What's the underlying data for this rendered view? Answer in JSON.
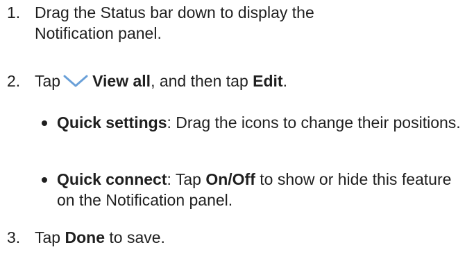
{
  "steps": [
    {
      "number": "1.",
      "text": "Drag the Status bar down to display the Notification panel."
    },
    {
      "number": "2.",
      "prefix": "Tap",
      "icon": "chevron-down-icon",
      "icon_color": "#6aa0d8",
      "view_all": "View all",
      "middle": ", and then tap",
      "edit": "Edit",
      "suffix": "."
    },
    {
      "number": "3.",
      "prefix": "Tap",
      "done": "Done",
      "suffix": "to save."
    }
  ],
  "bullets": [
    {
      "term": "Quick settings",
      "text": ": Drag the icons to change their positions."
    },
    {
      "term": "Quick connect",
      "pre": ": Tap",
      "onoff": "On/Off",
      "text": "to show or hide this feature on the Notification panel."
    }
  ]
}
